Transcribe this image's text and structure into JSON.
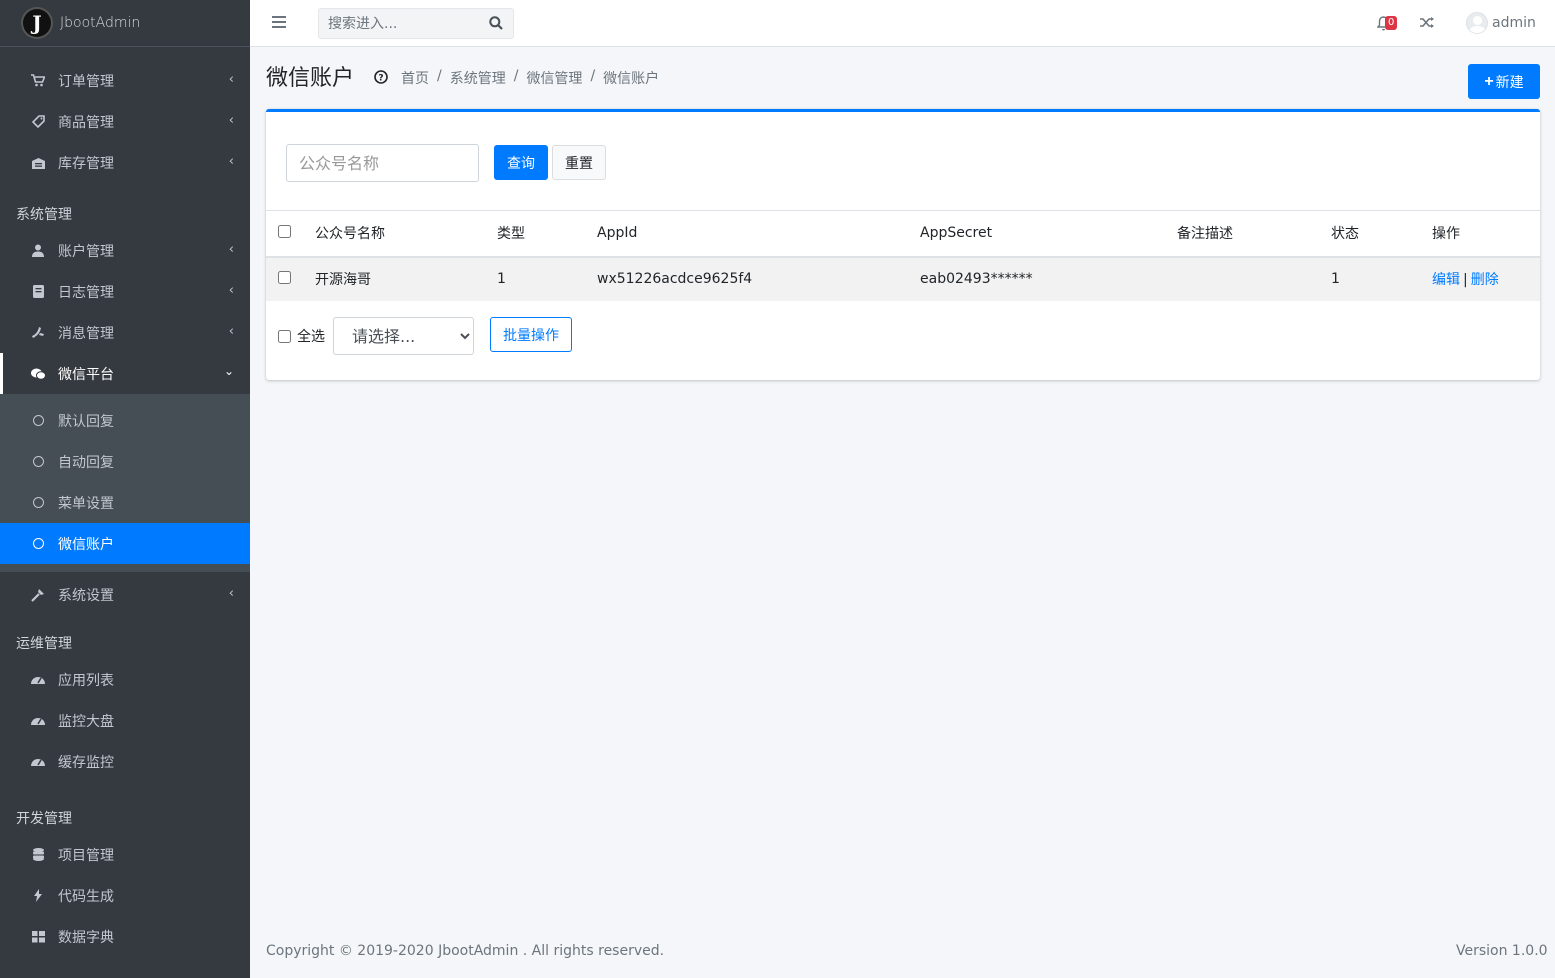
{
  "brand": {
    "logo_letter": "J",
    "name": "JbootAdmin"
  },
  "sidebar": {
    "group1": [
      {
        "label": "订单管理",
        "icon": "cart-icon"
      },
      {
        "label": "商品管理",
        "icon": "tag-icon"
      },
      {
        "label": "库存管理",
        "icon": "warehouse-icon"
      }
    ],
    "header_system": "系统管理",
    "system": [
      {
        "label": "账户管理",
        "icon": "user-icon"
      },
      {
        "label": "日志管理",
        "icon": "book-icon"
      },
      {
        "label": "消息管理",
        "icon": "message-icon"
      }
    ],
    "wechat": {
      "label": "微信平台",
      "icon": "wechat-icon"
    },
    "wechat_sub": [
      {
        "label": "默认回复"
      },
      {
        "label": "自动回复"
      },
      {
        "label": "菜单设置"
      },
      {
        "label": "微信账户"
      }
    ],
    "settings": {
      "label": "系统设置",
      "icon": "wrench-icon"
    },
    "header_ops": "运维管理",
    "ops": [
      {
        "label": "应用列表",
        "icon": "dashboard-icon"
      },
      {
        "label": "监控大盘",
        "icon": "dashboard-icon"
      },
      {
        "label": "缓存监控",
        "icon": "dashboard-icon"
      }
    ],
    "header_dev": "开发管理",
    "dev": [
      {
        "label": "项目管理",
        "icon": "database-icon"
      },
      {
        "label": "代码生成",
        "icon": "bolt-icon"
      },
      {
        "label": "数据字典",
        "icon": "grid-icon"
      }
    ]
  },
  "topbar": {
    "search_placeholder": "搜索进入...",
    "notification_count": "0",
    "user_name": "admin"
  },
  "page": {
    "title": "微信账户",
    "breadcrumb": [
      "首页",
      "系统管理",
      "微信管理",
      "微信账户"
    ],
    "new_button": "新建"
  },
  "filter": {
    "name_placeholder": "公众号名称",
    "query_button": "查询",
    "reset_button": "重置"
  },
  "table": {
    "headers": [
      "公众号名称",
      "类型",
      "AppId",
      "AppSecret",
      "备注描述",
      "状态",
      "操作"
    ],
    "rows": [
      {
        "name": "开源海哥",
        "type": "1",
        "appid": "wx51226acdce9625f4",
        "appsecret": "eab02493******",
        "remark": "",
        "status": "1",
        "edit": "编辑",
        "delete": "删除"
      }
    ]
  },
  "batch": {
    "select_all": "全选",
    "select_value": "请选择...",
    "button": "批量操作"
  },
  "footer": {
    "copyright": "Copyright © 2019-2020 JbootAdmin . All rights reserved.",
    "version": "Version 1.0.0"
  },
  "colors": {
    "primary": "#007bff",
    "sidebar_bg": "#343a40",
    "danger": "#dc3545"
  }
}
